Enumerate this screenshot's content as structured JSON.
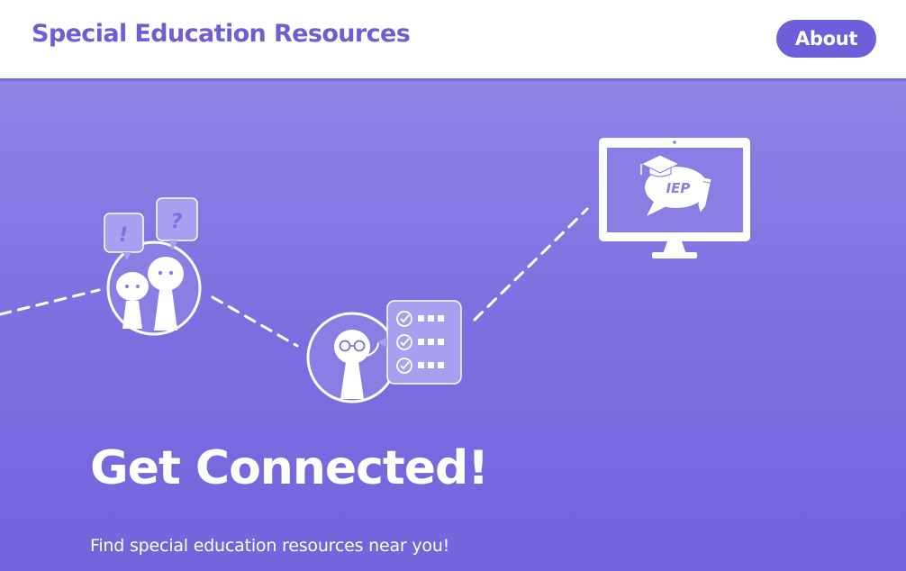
{
  "header": {
    "title": "Special Education Resources",
    "about_label": "About"
  },
  "hero": {
    "heading": "Get Connected!",
    "subheading": "Find special education resources near you!",
    "illustration": {
      "bubble_exclaim": "!",
      "bubble_question": "?",
      "monitor_text": "IEP"
    }
  },
  "colors": {
    "brand": "#6e5ed6",
    "hero_top": "#8e83e6",
    "hero_bottom": "#7364dc"
  }
}
